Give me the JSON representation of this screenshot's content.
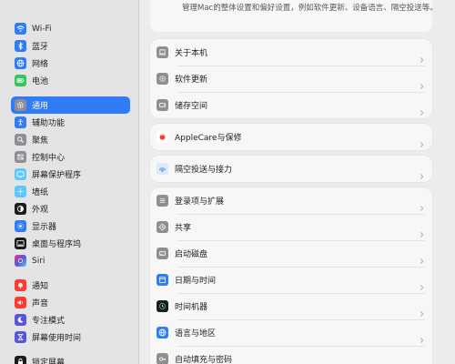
{
  "sidebar": {
    "items": [
      {
        "label": "Wi-Fi",
        "icon": "wifi-icon",
        "color": "#2f7cf6",
        "selected": false
      },
      {
        "label": "蓝牙",
        "icon": "bluetooth-icon",
        "color": "#2f7cf6",
        "selected": false
      },
      {
        "label": "网络",
        "icon": "globe-icon",
        "color": "#2f7cf6",
        "selected": false
      },
      {
        "label": "电池",
        "icon": "battery-icon",
        "color": "#34c759",
        "selected": false
      },
      {
        "label": "通用",
        "icon": "gear-icon",
        "color": "#8e8e93",
        "selected": true
      },
      {
        "label": "辅助功能",
        "icon": "accessibility-icon",
        "color": "#2f7cf6",
        "selected": false
      },
      {
        "label": "聚焦",
        "icon": "search-icon",
        "color": "#8e8e93",
        "selected": false
      },
      {
        "label": "控制中心",
        "icon": "control-center-icon",
        "color": "#8e8e93",
        "selected": false
      },
      {
        "label": "屏幕保护程序",
        "icon": "screensaver-icon",
        "color": "#5ac8fa",
        "selected": false
      },
      {
        "label": "墙纸",
        "icon": "wallpaper-icon",
        "color": "#5ac8fa",
        "selected": false
      },
      {
        "label": "外观",
        "icon": "appearance-icon",
        "color": "#1c1c1e",
        "selected": false
      },
      {
        "label": "显示器",
        "icon": "display-icon",
        "color": "#2f7cf6",
        "selected": false
      },
      {
        "label": "桌面与程序坞",
        "icon": "dock-icon",
        "color": "#1c1c1e",
        "selected": false
      },
      {
        "label": "Siri",
        "icon": "siri-icon",
        "color": "#5856d6",
        "selected": false
      },
      {
        "label": "通知",
        "icon": "bell-icon",
        "color": "#ff3b30",
        "selected": false
      },
      {
        "label": "声音",
        "icon": "speaker-icon",
        "color": "#ff3b30",
        "selected": false
      },
      {
        "label": "专注模式",
        "icon": "moon-icon",
        "color": "#5856d6",
        "selected": false
      },
      {
        "label": "屏幕使用时间",
        "icon": "hourglass-icon",
        "color": "#5856d6",
        "selected": false
      },
      {
        "label": "锁定屏幕",
        "icon": "lock-icon",
        "color": "#1c1c1e",
        "selected": false
      }
    ]
  },
  "main": {
    "description": "管理Mac的整体设置和偏好设置，例如软件更新、设备语言、隔空投送等。",
    "groups": [
      {
        "rows": [
          {
            "label": "关于本机",
            "icon": "laptop-icon",
            "color": "#8e8e93"
          },
          {
            "label": "软件更新",
            "icon": "gear-badge-icon",
            "color": "#8e8e93"
          },
          {
            "label": "储存空间",
            "icon": "storage-icon",
            "color": "#8e8e93"
          }
        ]
      },
      {
        "rows": [
          {
            "label": "AppleCare与保修",
            "icon": "apple-icon",
            "color": "#ff3b30"
          }
        ]
      },
      {
        "rows": [
          {
            "label": "隔空投送与接力",
            "icon": "airdrop-icon",
            "color": "#2f7cf6"
          }
        ]
      },
      {
        "rows": [
          {
            "label": "登录项与扩展",
            "icon": "list-icon",
            "color": "#8e8e93"
          },
          {
            "label": "共享",
            "icon": "share-icon",
            "color": "#8e8e93"
          },
          {
            "label": "启动磁盘",
            "icon": "disk-icon",
            "color": "#8e8e93"
          },
          {
            "label": "日期与时间",
            "icon": "calendar-icon",
            "color": "#2f7cf6"
          },
          {
            "label": "时间机器",
            "icon": "time-machine-icon",
            "color": "#1c1c1e"
          },
          {
            "label": "语言与地区",
            "icon": "language-icon",
            "color": "#2f7cf6"
          },
          {
            "label": "自动填充与密码",
            "icon": "key-icon",
            "color": "#8e8e93"
          }
        ]
      }
    ]
  }
}
